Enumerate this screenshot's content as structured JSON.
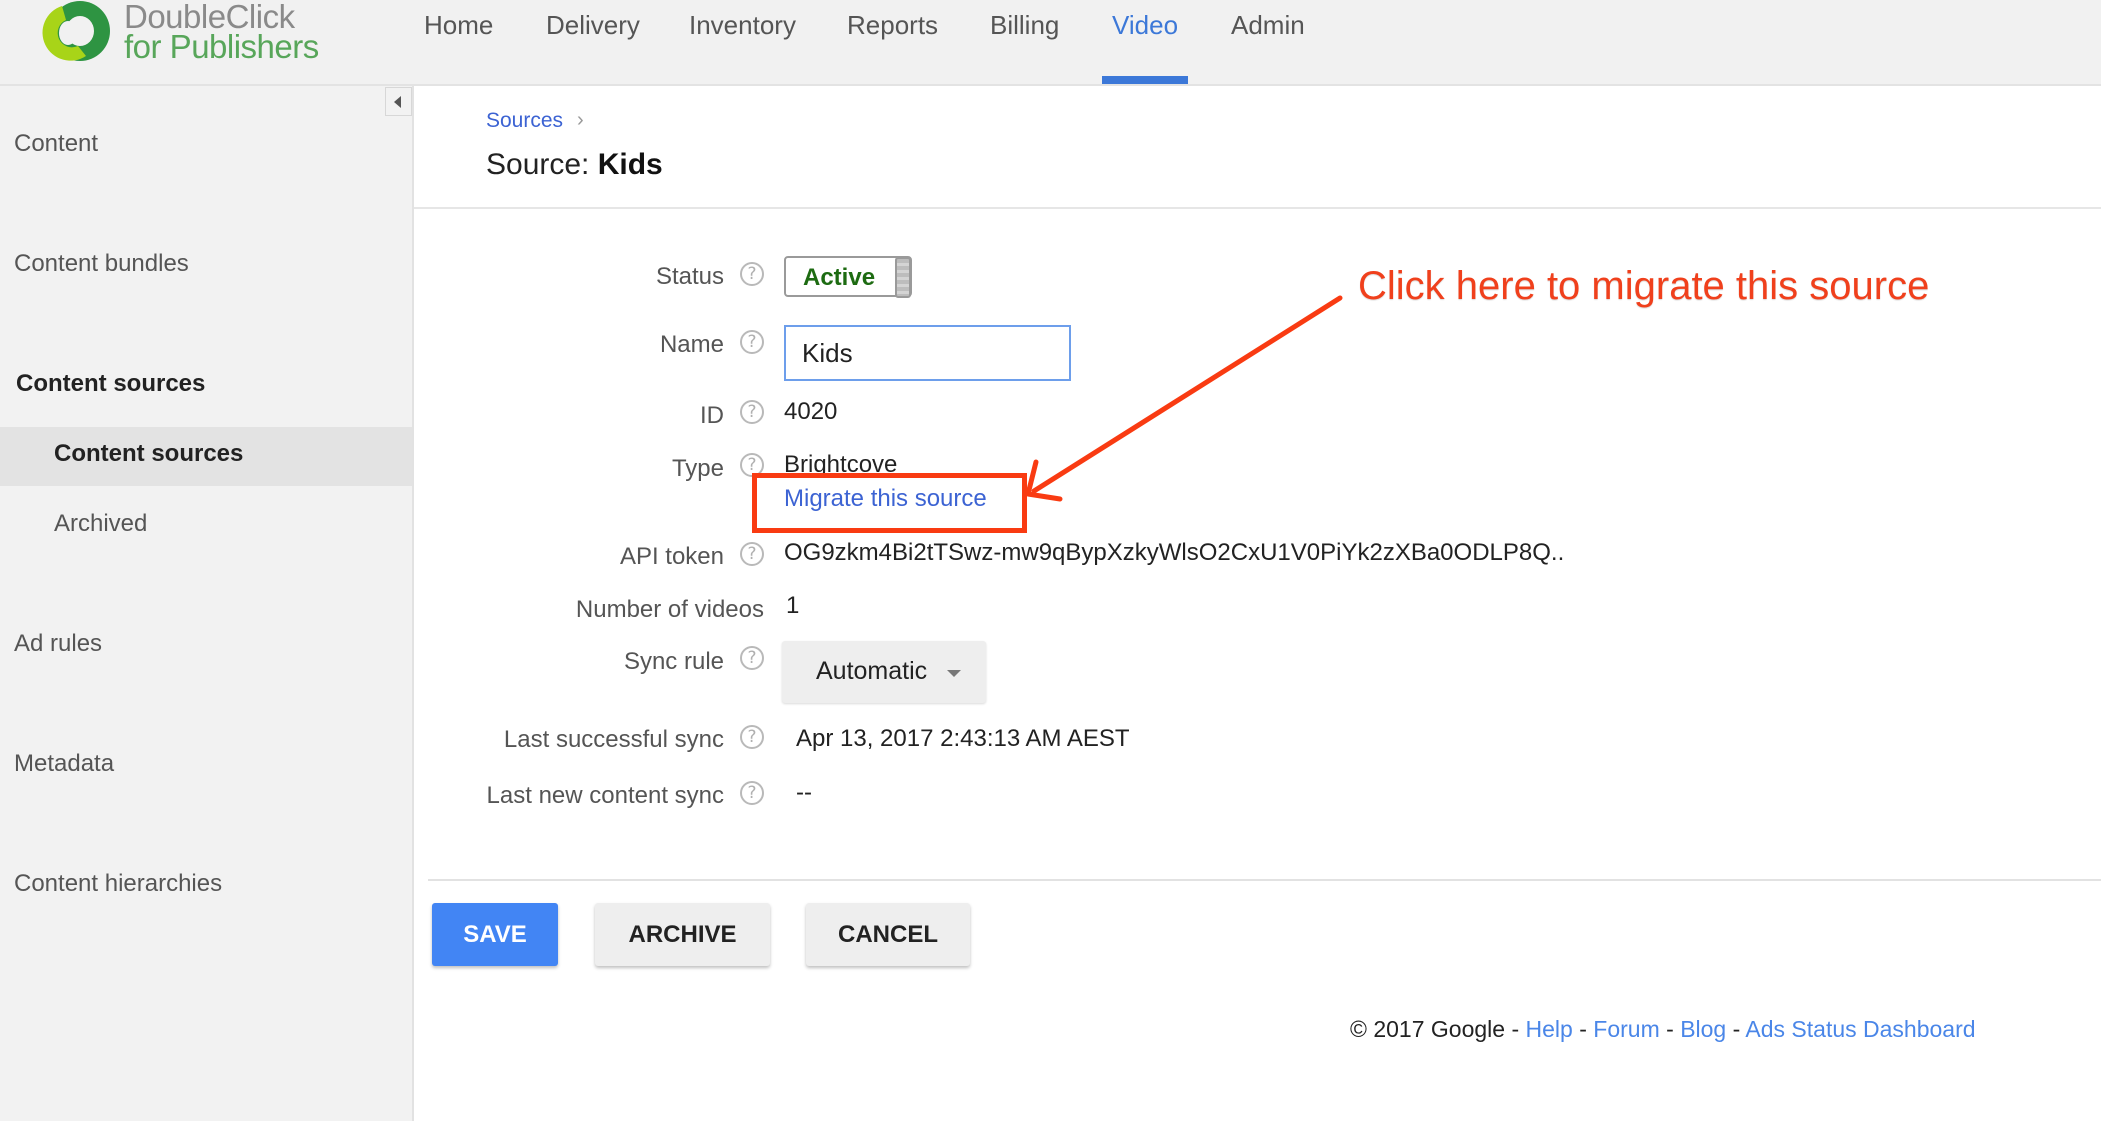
{
  "app": {
    "logo_line1": "DoubleClick",
    "logo_line2": "for Publishers",
    "brand_color": "#3c78d8"
  },
  "nav": {
    "items": [
      {
        "label": "Home",
        "active": false
      },
      {
        "label": "Delivery",
        "active": false
      },
      {
        "label": "Inventory",
        "active": false
      },
      {
        "label": "Reports",
        "active": false
      },
      {
        "label": "Billing",
        "active": false
      },
      {
        "label": "Video",
        "active": true
      },
      {
        "label": "Admin",
        "active": false
      }
    ]
  },
  "sidebar": {
    "collapse_icon": "triangle-left-icon",
    "items": [
      {
        "label": "Content"
      },
      {
        "label": "Content bundles"
      },
      {
        "label": "Content sources",
        "section_header": true
      },
      {
        "label": "Content sources",
        "sub": true,
        "selected": true
      },
      {
        "label": "Archived",
        "sub": true
      },
      {
        "label": "Ad rules"
      },
      {
        "label": "Metadata"
      },
      {
        "label": "Content hierarchies"
      }
    ]
  },
  "breadcrumb": {
    "link": "Sources",
    "separator": "›"
  },
  "page": {
    "title_prefix": "Source: ",
    "title_name": "Kids"
  },
  "form": {
    "help_glyph": "?",
    "status": {
      "label": "Status",
      "value": "Active",
      "value_color": "#1d6b12"
    },
    "name": {
      "label": "Name",
      "value": "Kids"
    },
    "id": {
      "label": "ID",
      "value": "4020"
    },
    "type": {
      "label": "Type",
      "value": "Brightcove",
      "migrate_link": "Migrate this source"
    },
    "api_token": {
      "label": "API token",
      "value": "OG9zkm4Bi2tTSwz-mw9qBypXzkyWlsO2CxU1V0PiYk2zXBa0ODLP8Q.."
    },
    "num_videos": {
      "label": "Number of videos",
      "value": "1"
    },
    "sync_rule": {
      "label": "Sync rule",
      "value": "Automatic"
    },
    "last_sync": {
      "label": "Last successful sync",
      "value": "Apr 13, 2017 2:43:13 AM AEST"
    },
    "last_new_content_sync": {
      "label": "Last new content sync",
      "value": "--"
    }
  },
  "actions": {
    "save": "SAVE",
    "archive": "ARCHIVE",
    "cancel": "CANCEL"
  },
  "footer": {
    "copyright": "© 2017 Google",
    "sep": " - ",
    "links": [
      "Help",
      "Forum",
      "Blog",
      "Ads Status Dashboard"
    ]
  },
  "annotation": {
    "text": "Click here to migrate this source",
    "color": "#f93b12"
  }
}
